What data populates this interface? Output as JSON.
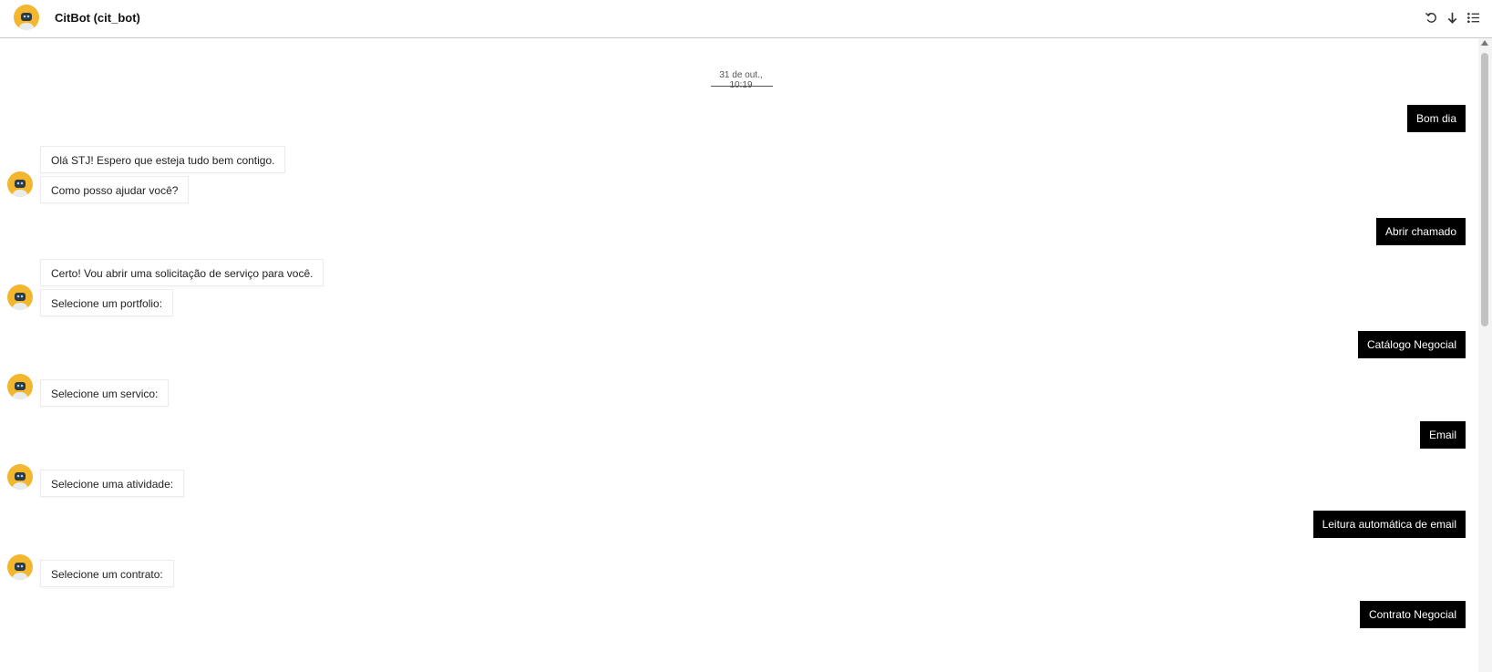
{
  "header": {
    "title": "CitBot (cit_bot)",
    "actions": [
      "undo-icon",
      "arrow-down-icon",
      "list-icon"
    ]
  },
  "colors": {
    "avatar": "#f3b72f",
    "user_bubble": "#000000",
    "bot_bubble_border": "#ececec"
  },
  "chat": {
    "date": "31 de out., 10:19",
    "messages": [
      {
        "from": "user",
        "text": "Bom dia"
      },
      {
        "from": "bot",
        "text": "Olá STJ! Espero que esteja tudo bem contigo."
      },
      {
        "from": "bot",
        "text": "Como posso ajudar você?"
      },
      {
        "from": "user",
        "text": "Abrir chamado"
      },
      {
        "from": "bot",
        "text": "Certo! Vou abrir uma solicitação de serviço para você."
      },
      {
        "from": "bot",
        "text": "Selecione um portfolio:"
      },
      {
        "from": "user",
        "text": "Catálogo Negocial"
      },
      {
        "from": "bot",
        "text": "Selecione um servico:"
      },
      {
        "from": "user",
        "text": "Email"
      },
      {
        "from": "bot",
        "text": "Selecione uma atividade:"
      },
      {
        "from": "user",
        "text": "Leitura automática de email"
      },
      {
        "from": "bot",
        "text": "Selecione um contrato:"
      },
      {
        "from": "user",
        "text": "Contrato Negocial"
      }
    ]
  }
}
